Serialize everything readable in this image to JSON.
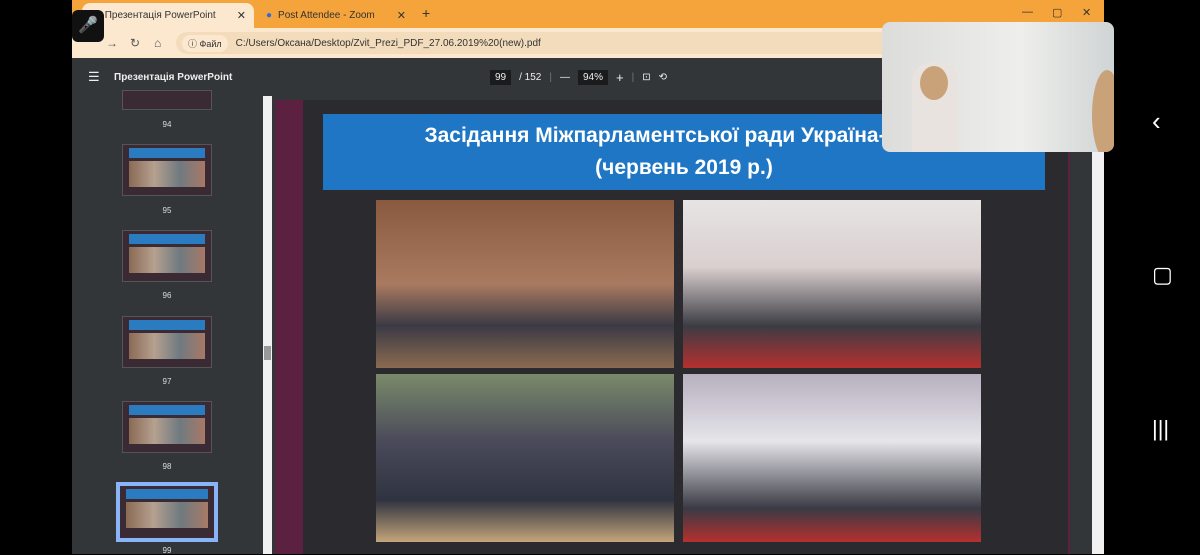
{
  "browser": {
    "tabs": [
      {
        "label": "Презентація PowerPoint"
      },
      {
        "label": "Post Attendee - Zoom"
      }
    ],
    "address": "C:/Users/Оксана/Desktop/Zvit_Prezi_PDF_27.06.2019%20(new).pdf",
    "file_badge": "Файл"
  },
  "pdf": {
    "title": "Презентація PowerPoint",
    "page": "99",
    "total": "/ 152",
    "zoom": "94%"
  },
  "thumbs": [
    {
      "n": "94"
    },
    {
      "n": "95"
    },
    {
      "n": "96"
    },
    {
      "n": "97"
    },
    {
      "n": "98"
    },
    {
      "n": "99"
    }
  ],
  "slide": {
    "title_line1": "Засідання Міжпарламентської ради Україна-НАТО",
    "title_line2": "(червень 2019 р.)"
  }
}
